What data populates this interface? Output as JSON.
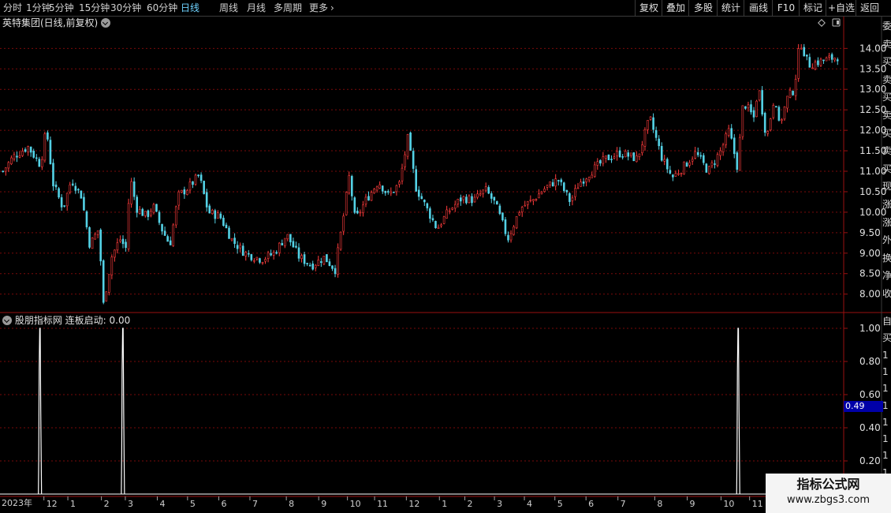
{
  "toolbar": {
    "periods": [
      {
        "label": "分时",
        "active": false
      },
      {
        "label": "1分钟",
        "active": false
      },
      {
        "label": "5分钟",
        "active": false
      },
      {
        "label": "15分钟",
        "active": false
      },
      {
        "label": "30分钟",
        "active": false
      },
      {
        "label": "60分钟",
        "active": false
      },
      {
        "label": "日线",
        "active": true
      },
      {
        "label": "周线",
        "active": false
      },
      {
        "label": "月线",
        "active": false
      },
      {
        "label": "多周期",
        "active": false
      },
      {
        "label": "更多",
        "active": false
      }
    ],
    "actions": [
      "复权",
      "叠加",
      "多股",
      "统计",
      "画线",
      "F10",
      "标记",
      "+自选",
      "返回"
    ]
  },
  "chart": {
    "title": "英特集团(日线,前复权)",
    "price_axis": [
      "14.00",
      "13.50",
      "13.00",
      "12.50",
      "12.00",
      "11.50",
      "11.00",
      "10.50",
      "10.00",
      "9.50",
      "9.00",
      "8.50",
      "8.00"
    ],
    "price_range": [
      7.55,
      14.45
    ],
    "colors": {
      "up": "#ff3c3c",
      "down": "#54d2e6",
      "grid": "#7a0a0a",
      "border": "#9a1010",
      "indicator": "#ffffff"
    }
  },
  "indicator": {
    "source": "股朋指标网",
    "name": "连板启动:",
    "value": "0.00",
    "axis": [
      "1.00",
      "0.80",
      "0.60",
      "0.40",
      "0.20"
    ],
    "current_value": "0.49",
    "signals": [
      0.0474,
      0.1458,
      0.8758
    ]
  },
  "time_axis": {
    "year": "2023年",
    "months": [
      {
        "label": "12",
        "pos": 0.0521
      },
      {
        "label": "1",
        "pos": 0.0805
      },
      {
        "label": "2",
        "pos": 0.1203
      },
      {
        "label": "3",
        "pos": 0.1487
      },
      {
        "label": "4",
        "pos": 0.1866
      },
      {
        "label": "5",
        "pos": 0.2225
      },
      {
        "label": "6",
        "pos": 0.2596
      },
      {
        "label": "7",
        "pos": 0.2965
      },
      {
        "label": "8",
        "pos": 0.3397
      },
      {
        "label": "9",
        "pos": 0.3781
      },
      {
        "label": "10",
        "pos": 0.4122
      },
      {
        "label": "11",
        "pos": 0.4444
      },
      {
        "label": "12",
        "pos": 0.4821
      },
      {
        "label": "1",
        "pos": 0.5213
      },
      {
        "label": "2",
        "pos": 0.5515
      },
      {
        "label": "3",
        "pos": 0.5866
      },
      {
        "label": "4",
        "pos": 0.6221
      },
      {
        "label": "5",
        "pos": 0.6583
      },
      {
        "label": "6",
        "pos": 0.6952
      },
      {
        "label": "7",
        "pos": 0.7331
      },
      {
        "label": "8",
        "pos": 0.7768
      },
      {
        "label": "9",
        "pos": 0.8153
      },
      {
        "label": "10",
        "pos": 0.8554
      },
      {
        "label": "11",
        "pos": 0.8893
      }
    ]
  },
  "watermark": {
    "title": "指标公式网",
    "url": "www.zbgs3.com"
  },
  "right_strip": {
    "top": [
      "委",
      "卖",
      "买",
      "卖",
      "买",
      "卖",
      "买",
      "卖",
      "买",
      "现",
      "涨",
      "涨",
      "外",
      "换",
      "净",
      "收"
    ],
    "bottom": [
      "自",
      "买",
      "1",
      "1",
      "1",
      "1",
      "1",
      "1",
      "1",
      "1",
      "1"
    ]
  },
  "price_series": {
    "anchors": [
      [
        0.0,
        11.0
      ],
      [
        0.012,
        11.35
      ],
      [
        0.03,
        11.6
      ],
      [
        0.045,
        11.15
      ],
      [
        0.052,
        12.05
      ],
      [
        0.06,
        10.7
      ],
      [
        0.072,
        10.1
      ],
      [
        0.082,
        10.8
      ],
      [
        0.094,
        10.4
      ],
      [
        0.104,
        9.2
      ],
      [
        0.115,
        9.6
      ],
      [
        0.12,
        7.7
      ],
      [
        0.13,
        8.9
      ],
      [
        0.14,
        9.35
      ],
      [
        0.148,
        9.1
      ],
      [
        0.152,
        10.9
      ],
      [
        0.16,
        10.1
      ],
      [
        0.172,
        9.9
      ],
      [
        0.18,
        10.15
      ],
      [
        0.19,
        9.6
      ],
      [
        0.2,
        9.2
      ],
      [
        0.21,
        10.4
      ],
      [
        0.222,
        10.6
      ],
      [
        0.235,
        10.9
      ],
      [
        0.246,
        10.0
      ],
      [
        0.26,
        9.9
      ],
      [
        0.275,
        9.3
      ],
      [
        0.29,
        9.0
      ],
      [
        0.31,
        8.85
      ],
      [
        0.325,
        9.0
      ],
      [
        0.34,
        9.45
      ],
      [
        0.355,
        8.9
      ],
      [
        0.37,
        8.7
      ],
      [
        0.385,
        8.9
      ],
      [
        0.398,
        8.6
      ],
      [
        0.408,
        9.9
      ],
      [
        0.415,
        10.9
      ],
      [
        0.422,
        9.8
      ],
      [
        0.435,
        10.3
      ],
      [
        0.45,
        10.75
      ],
      [
        0.462,
        10.4
      ],
      [
        0.475,
        10.7
      ],
      [
        0.485,
        11.8
      ],
      [
        0.495,
        10.6
      ],
      [
        0.51,
        10.0
      ],
      [
        0.52,
        9.6
      ],
      [
        0.535,
        10.05
      ],
      [
        0.55,
        10.35
      ],
      [
        0.565,
        10.3
      ],
      [
        0.578,
        10.55
      ],
      [
        0.59,
        10.2
      ],
      [
        0.605,
        9.35
      ],
      [
        0.62,
        10.1
      ],
      [
        0.635,
        10.3
      ],
      [
        0.65,
        10.6
      ],
      [
        0.665,
        10.8
      ],
      [
        0.68,
        10.25
      ],
      [
        0.69,
        10.7
      ],
      [
        0.705,
        11.0
      ],
      [
        0.722,
        11.3
      ],
      [
        0.74,
        11.45
      ],
      [
        0.76,
        11.3
      ],
      [
        0.775,
        12.3
      ],
      [
        0.79,
        11.3
      ],
      [
        0.802,
        10.85
      ],
      [
        0.815,
        11.1
      ],
      [
        0.83,
        11.45
      ],
      [
        0.845,
        11.0
      ],
      [
        0.86,
        11.5
      ],
      [
        0.87,
        12.0
      ],
      [
        0.88,
        11.1
      ],
      [
        0.887,
        12.7
      ],
      [
        0.9,
        12.3
      ],
      [
        0.905,
        13.1
      ],
      [
        0.915,
        11.8
      ],
      [
        0.925,
        12.9
      ],
      [
        0.93,
        12.1
      ],
      [
        0.94,
        12.8
      ],
      [
        0.948,
        13.0
      ],
      [
        0.955,
        14.2
      ],
      [
        0.965,
        13.6
      ],
      [
        1.0,
        13.8
      ]
    ]
  }
}
